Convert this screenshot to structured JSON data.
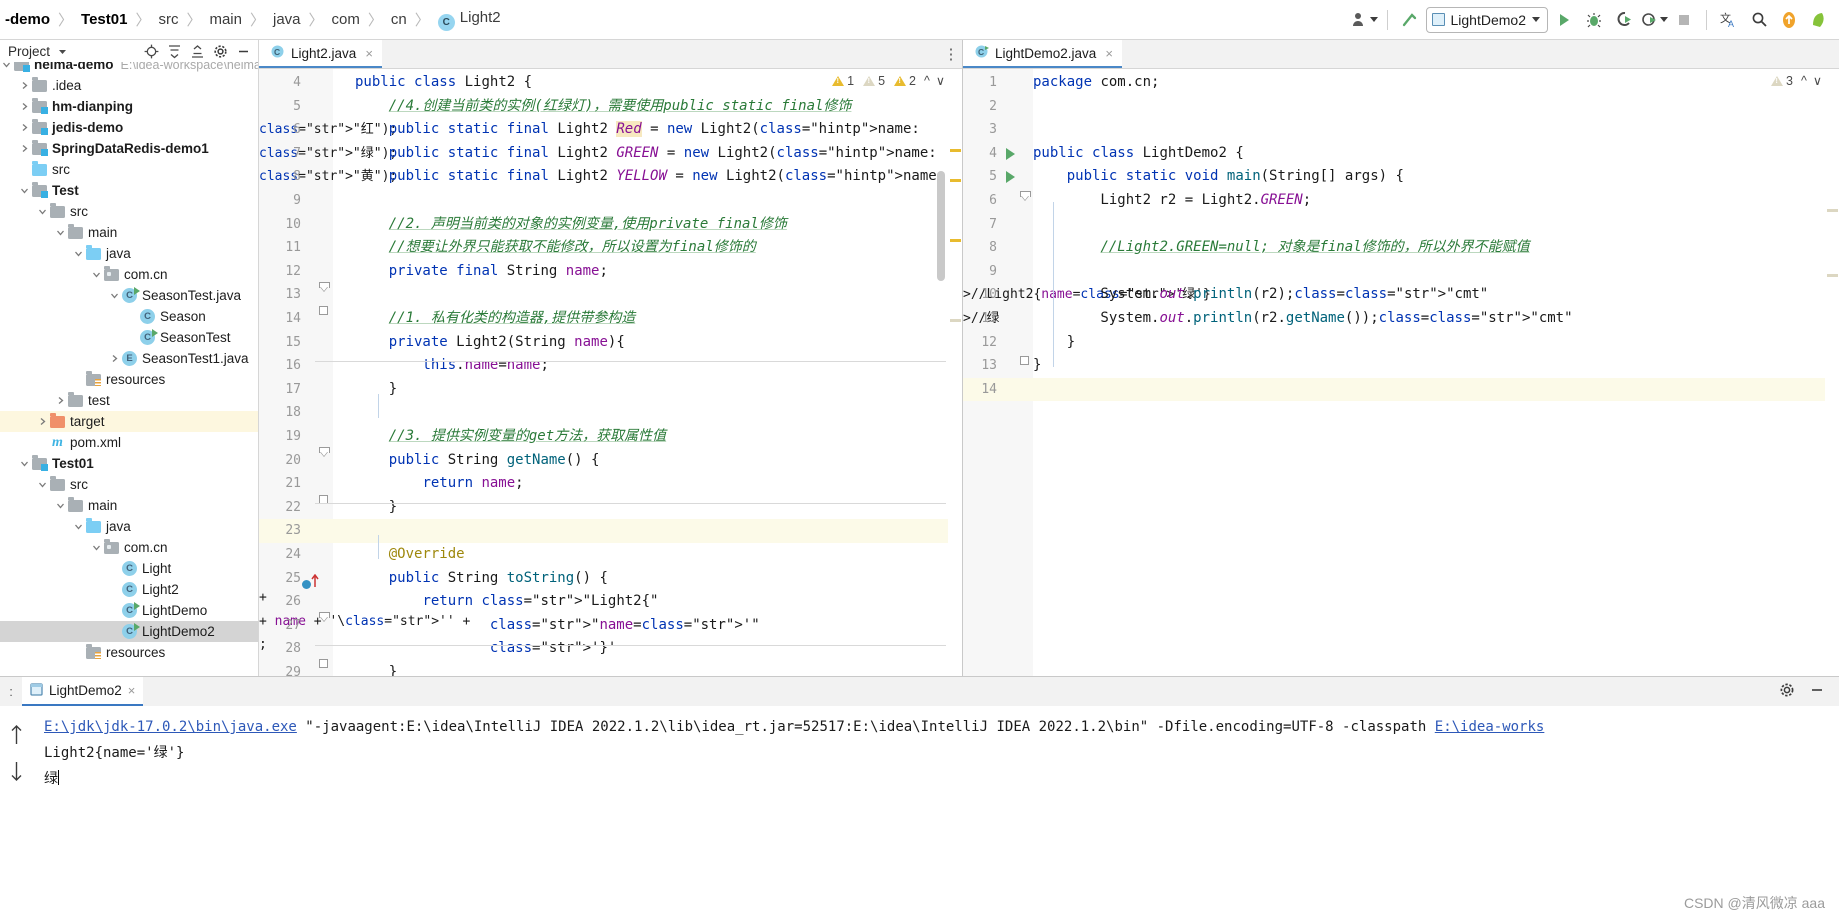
{
  "breadcrumb": {
    "items": [
      {
        "label": "-demo",
        "bold": true,
        "icon": null
      },
      {
        "label": "Test01",
        "bold": true,
        "icon": null
      },
      {
        "label": "src",
        "bold": false,
        "icon": null
      },
      {
        "label": "main",
        "bold": false,
        "icon": null
      },
      {
        "label": "java",
        "bold": false,
        "icon": null
      },
      {
        "label": "com",
        "bold": false,
        "icon": null
      },
      {
        "label": "cn",
        "bold": false,
        "icon": null
      },
      {
        "label": "Light2",
        "bold": false,
        "icon": "class-icon",
        "badge": "C"
      }
    ]
  },
  "toolbar": {
    "run_config_label": "LightDemo2",
    "buttons": [
      {
        "name": "user-account-icon",
        "glyph": "account"
      },
      {
        "name": "build-hammer-icon",
        "glyph": "hammer"
      },
      {
        "name": "run-button",
        "glyph": "play"
      },
      {
        "name": "debug-button",
        "glyph": "bug"
      },
      {
        "name": "run-with-coverage-button",
        "glyph": "coverage"
      },
      {
        "name": "profiler-button",
        "glyph": "profile"
      },
      {
        "name": "stop-button",
        "glyph": "stop"
      },
      {
        "name": "translate-icon",
        "glyph": "translate"
      },
      {
        "name": "search-everywhere-icon",
        "glyph": "search"
      },
      {
        "name": "update-icon",
        "glyph": "arrow-up-circle"
      },
      {
        "name": "notifications-icon",
        "glyph": "bell"
      }
    ]
  },
  "sidebar": {
    "title": "Project",
    "header_icons": [
      "locate-icon",
      "expand-all-icon",
      "collapse-all-icon",
      "settings-gear-icon",
      "hide-icon"
    ],
    "tree": [
      {
        "depth": 0,
        "arrow": "down",
        "icon": "module-folder",
        "label": "heima-demo",
        "bold": true,
        "path": "E:\\idea-workspace\\heima",
        "clipped": true
      },
      {
        "depth": 1,
        "arrow": "right",
        "icon": "folder-gray",
        "label": ".idea",
        "bold": false
      },
      {
        "depth": 1,
        "arrow": "right",
        "icon": "module-folder",
        "label": "hm-dianping",
        "bold": true
      },
      {
        "depth": 1,
        "arrow": "right",
        "icon": "module-folder",
        "label": "jedis-demo",
        "bold": true
      },
      {
        "depth": 1,
        "arrow": "right",
        "icon": "module-folder",
        "label": "SpringDataRedis-demo1",
        "bold": true
      },
      {
        "depth": 1,
        "arrow": "none",
        "icon": "folder-blue",
        "label": "src",
        "bold": false
      },
      {
        "depth": 1,
        "arrow": "down",
        "icon": "module-folder",
        "label": "Test",
        "bold": true
      },
      {
        "depth": 2,
        "arrow": "down",
        "icon": "folder-gray",
        "label": "src",
        "bold": false
      },
      {
        "depth": 3,
        "arrow": "down",
        "icon": "folder-gray",
        "label": "main",
        "bold": false
      },
      {
        "depth": 4,
        "arrow": "down",
        "icon": "folder-blue",
        "label": "java",
        "bold": false
      },
      {
        "depth": 5,
        "arrow": "down",
        "icon": "package-folder",
        "label": "com.cn",
        "bold": false
      },
      {
        "depth": 6,
        "arrow": "down",
        "icon": "class-runnable",
        "label": "SeasonTest.java",
        "bold": false
      },
      {
        "depth": 7,
        "arrow": "none",
        "icon": "class",
        "label": "Season",
        "bold": false
      },
      {
        "depth": 7,
        "arrow": "none",
        "icon": "class-runnable",
        "label": "SeasonTest",
        "bold": false
      },
      {
        "depth": 6,
        "arrow": "right",
        "icon": "enum",
        "label": "SeasonTest1.java",
        "bold": false
      },
      {
        "depth": 4,
        "arrow": "none",
        "icon": "resources-folder",
        "label": "resources",
        "bold": false
      },
      {
        "depth": 3,
        "arrow": "right",
        "icon": "folder-gray",
        "label": "test",
        "bold": false
      },
      {
        "depth": 2,
        "arrow": "right",
        "icon": "folder-orange",
        "label": "target",
        "bold": false,
        "highlight": true
      },
      {
        "depth": 2,
        "arrow": "none",
        "icon": "maven",
        "label": "pom.xml",
        "bold": false
      },
      {
        "depth": 1,
        "arrow": "down",
        "icon": "module-folder",
        "label": "Test01",
        "bold": true
      },
      {
        "depth": 2,
        "arrow": "down",
        "icon": "folder-gray",
        "label": "src",
        "bold": false
      },
      {
        "depth": 3,
        "arrow": "down",
        "icon": "folder-gray",
        "label": "main",
        "bold": false
      },
      {
        "depth": 4,
        "arrow": "down",
        "icon": "folder-blue",
        "label": "java",
        "bold": false
      },
      {
        "depth": 5,
        "arrow": "down",
        "icon": "package-folder",
        "label": "com.cn",
        "bold": false
      },
      {
        "depth": 6,
        "arrow": "none",
        "icon": "class",
        "label": "Light",
        "bold": false
      },
      {
        "depth": 6,
        "arrow": "none",
        "icon": "class",
        "label": "Light2",
        "bold": false
      },
      {
        "depth": 6,
        "arrow": "none",
        "icon": "class-runnable",
        "label": "LightDemo",
        "bold": false
      },
      {
        "depth": 6,
        "arrow": "none",
        "icon": "class-runnable",
        "label": "LightDemo2",
        "bold": false,
        "selected": true
      },
      {
        "depth": 4,
        "arrow": "none",
        "icon": "resources-folder",
        "label": "resources",
        "bold": false
      }
    ]
  },
  "editor_left": {
    "tab": {
      "label": "Light2.java",
      "icon": "java-class-icon",
      "close": "×"
    },
    "inspections": {
      "warnings": "1",
      "weak": "5",
      "errors": "2"
    },
    "first_line_number": 4,
    "lines": [
      {
        "n": 4,
        "text": "public class Light2 {"
      },
      {
        "n": 5,
        "text": "    //4.创建当前类的实例(红绿灯)，需要使用public static final修饰"
      },
      {
        "n": 6,
        "text": "    public static final Light2 Red = new Light2( name: \"红\");"
      },
      {
        "n": 7,
        "text": "    public static final Light2 GREEN = new Light2( name: \"绿\");"
      },
      {
        "n": 8,
        "text": "    public static final Light2 YELLOW = new Light2( name: \"黄\");"
      },
      {
        "n": 9,
        "text": ""
      },
      {
        "n": 10,
        "text": "    //2. 声明当前类的对象的实例变量,使用private final修饰"
      },
      {
        "n": 11,
        "text": "    //想要让外界只能获取不能修改，所以设置为final修饰的"
      },
      {
        "n": 12,
        "text": "    private final String name;"
      },
      {
        "n": 13,
        "text": ""
      },
      {
        "n": 14,
        "text": "    //1. 私有化类的构造器,提供带参构造"
      },
      {
        "n": 15,
        "text": "    private Light2(String name){"
      },
      {
        "n": 16,
        "text": "        this.name=name;"
      },
      {
        "n": 17,
        "text": "    }"
      },
      {
        "n": 18,
        "text": ""
      },
      {
        "n": 19,
        "text": "    //3. 提供实例变量的get方法，获取属性值"
      },
      {
        "n": 20,
        "text": "    public String getName() {"
      },
      {
        "n": 21,
        "text": "        return name;"
      },
      {
        "n": 22,
        "text": "    }"
      },
      {
        "n": 23,
        "text": "",
        "current": true
      },
      {
        "n": 24,
        "text": "    @Override"
      },
      {
        "n": 25,
        "text": "    public String toString() {"
      },
      {
        "n": 26,
        "text": "        return \"Light2{\" +"
      },
      {
        "n": 27,
        "text": "                \"name='\" + name + '\\'' +"
      },
      {
        "n": 28,
        "text": "                '}';"
      },
      {
        "n": 29,
        "text": "    }"
      }
    ]
  },
  "editor_right": {
    "tab": {
      "label": "LightDemo2.java",
      "icon": "java-class-icon",
      "close": "×"
    },
    "inspections": {
      "weak": "3"
    },
    "lines": [
      {
        "n": 1,
        "text": "package com.cn;"
      },
      {
        "n": 2,
        "text": ""
      },
      {
        "n": 3,
        "text": ""
      },
      {
        "n": 4,
        "text": "public class LightDemo2 {",
        "gutter_run": true
      },
      {
        "n": 5,
        "text": "    public static void main(String[] args) {",
        "gutter_run": true
      },
      {
        "n": 6,
        "text": "        Light2 r2 = Light2.GREEN;"
      },
      {
        "n": 7,
        "text": ""
      },
      {
        "n": 8,
        "text": "        //Light2.GREEN=null; 对象是final修饰的，所以外界不能赋值"
      },
      {
        "n": 9,
        "text": ""
      },
      {
        "n": 10,
        "text": "        System.out.println(r2);//Light2{name='绿'}"
      },
      {
        "n": 11,
        "text": "        System.out.println(r2.getName());//绿"
      },
      {
        "n": 12,
        "text": "    }"
      },
      {
        "n": 13,
        "text": "}"
      },
      {
        "n": 14,
        "text": "",
        "current": true
      }
    ]
  },
  "run_panel": {
    "prefix": ":",
    "tab": {
      "label": "LightDemo2",
      "close": "×"
    },
    "side_buttons": [
      "scroll-up-icon",
      "scroll-down-icon"
    ],
    "right_icons": [
      "settings-gear-icon",
      "minimize-icon"
    ],
    "console": [
      {
        "link": "E:\\jdk\\jdk-17.0.2\\bin\\java.exe",
        "rest": " \"-javaagent:E:\\idea\\IntelliJ IDEA 2022.1.2\\lib\\idea_rt.jar=52517:E:\\idea\\IntelliJ IDEA 2022.1.2\\bin\" -Dfile.encoding=UTF-8 -classpath ",
        "link2": "E:\\idea-works"
      },
      {
        "text": "Light2{name='绿'}"
      },
      {
        "text": "绿",
        "caret": true
      }
    ]
  },
  "watermark": "CSDN @清风微凉 aaa",
  "colors": {
    "accent_blue": "#3a78c2",
    "keyword": "#0033b3",
    "string": "#067d17",
    "comment": "#2a7a38",
    "field": "#871094",
    "method": "#00627a",
    "annotation": "#9e880d",
    "run_green": "#59a869",
    "warning_yellow": "#e8bb2e",
    "selection_gray": "#d4d4d4"
  }
}
